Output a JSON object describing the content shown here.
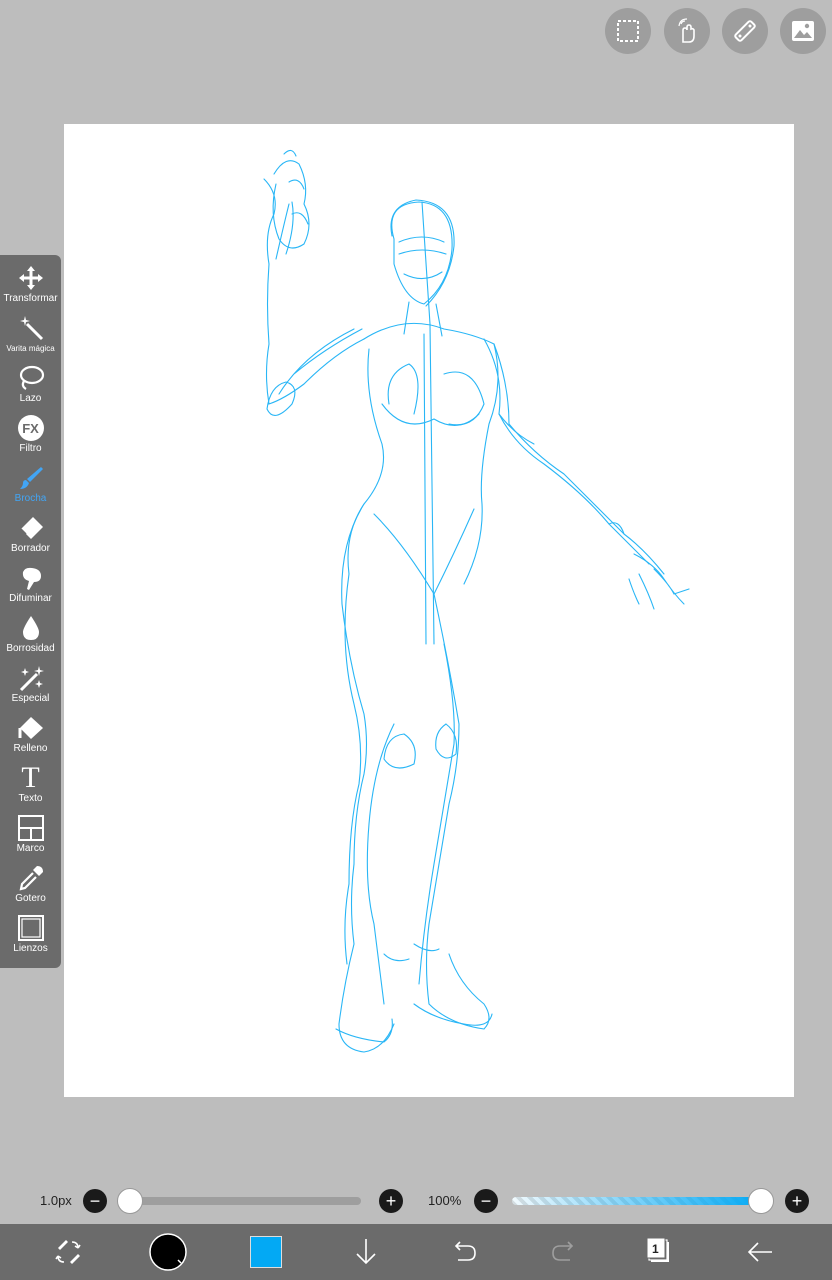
{
  "toolbar": {
    "tools": [
      {
        "label": "Transformar",
        "icon": "move-icon"
      },
      {
        "label": "Varita mágica",
        "icon": "magic-wand-icon"
      },
      {
        "label": "Lazo",
        "icon": "lasso-icon"
      },
      {
        "label": "Filtro",
        "icon": "fx-icon",
        "glyph": "FX"
      },
      {
        "label": "Brocha",
        "icon": "brush-icon"
      },
      {
        "label": "Borrador",
        "icon": "eraser-icon"
      },
      {
        "label": "Difuminar",
        "icon": "smudge-icon"
      },
      {
        "label": "Borrosidad",
        "icon": "blur-drop-icon"
      },
      {
        "label": "Especial",
        "icon": "sparkle-icon"
      },
      {
        "label": "Relleno",
        "icon": "fill-bucket-icon"
      },
      {
        "label": "Texto",
        "icon": "text-icon",
        "glyph": "T"
      },
      {
        "label": "Marco",
        "icon": "frame-icon"
      },
      {
        "label": "Gotero",
        "icon": "eyedropper-icon"
      },
      {
        "label": "Lienzos",
        "icon": "canvas-icon"
      }
    ],
    "active": "Brocha"
  },
  "top_buttons": [
    "selection-icon",
    "hand-gesture-icon",
    "ruler-icon",
    "image-icon"
  ],
  "brush_size": {
    "value_label": "1.0px",
    "minus": "−",
    "plus": "+",
    "level": 0.0
  },
  "opacity": {
    "value_label": "100%",
    "minus": "−",
    "plus": "+",
    "level": 1.0
  },
  "bottom_bar": {
    "layer_count": "1",
    "icons": [
      "swap-tool-icon",
      "color-picker-icon",
      "current-color-icon",
      "download-icon",
      "undo-icon",
      "redo-icon",
      "layers-icon",
      "back-icon"
    ]
  },
  "colors": {
    "background": "#bdbdbd",
    "panel": "#6b6b6b",
    "accent": "#42a5f5",
    "current_color": "#03a9f4",
    "sketch": "#29b6f6"
  }
}
